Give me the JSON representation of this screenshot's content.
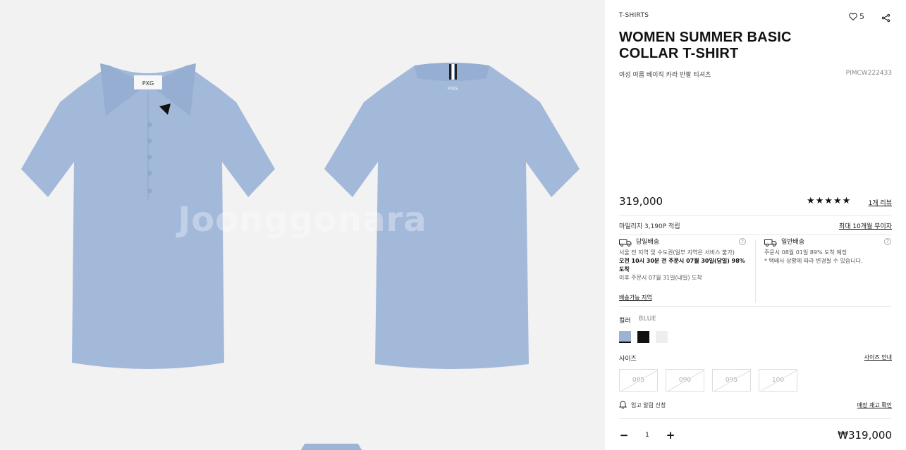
{
  "gallery": {
    "watermark": "Joonggonara",
    "shirt_color": "#a3b9da",
    "shirt_shade": "#8fa8cc",
    "images": [
      {
        "view": "front",
        "logo_text": "PXG"
      },
      {
        "view": "back",
        "logo_text": "PXG"
      }
    ]
  },
  "product": {
    "category": "T-SHIRTS",
    "likes": "5",
    "like_icon": "heart-outline-icon",
    "share_icon": "share-icon",
    "title_line1": "WOMEN SUMMER BASIC",
    "title_line2": "COLLAR T-SHIRT",
    "subtitle_ko": "여성 여름 베이직 카라 반팔 티셔츠",
    "code": "PIMCW222433",
    "price": "319,000",
    "rating_stars": "★★★★★",
    "rating_value": 5,
    "review_link": "1개 리뷰"
  },
  "benefits": {
    "mileage": "마일리지 3,190P 적립",
    "installment_link": "최대 10개월 무이자"
  },
  "shipping": {
    "same_day": {
      "title": "당일배송",
      "line1": "서울 전 지역 및 수도권(일부 지역은 서비스 불가)",
      "line2": "오전 10시 30분 전 주문시 07월 30일(당일) 98% 도착",
      "line3": "이후 주문시 07월 31일(내일) 도착",
      "area_link": "배송가능 지역"
    },
    "standard": {
      "title": "일반배송",
      "line1": "주문시 08월 01일 89% 도착 예정",
      "line2": "* 택배사 상황에 따라 변경될 수 있습니다."
    },
    "help_glyph": "?"
  },
  "options": {
    "color_label": "컬러",
    "color_selected": "BLUE",
    "colors": [
      {
        "name": "blue",
        "hex": "#9db3d4",
        "selected": true
      },
      {
        "name": "black",
        "hex": "#111111",
        "selected": false
      },
      {
        "name": "white",
        "hex": "#eeeeee",
        "selected": false
      }
    ],
    "size_label": "사이즈",
    "size_guide_link": "사이즈 안내",
    "sizes": [
      "085",
      "090",
      "095",
      "100"
    ],
    "sizes_sold_out": true
  },
  "actions": {
    "restock_notify": "입고 알림 신청",
    "store_stock_link": "매장 재고 확인"
  },
  "order": {
    "quantity": "1",
    "minus": "−",
    "plus": "+",
    "total_price": "₩319,000"
  }
}
